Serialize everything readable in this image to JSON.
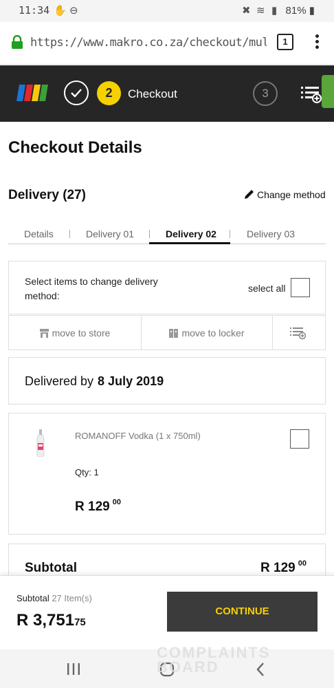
{
  "status_bar": {
    "time": "11:34",
    "battery": "81%"
  },
  "browser": {
    "url": "https://www.makro.co.za/checkout/multi/del",
    "tab_count": "1"
  },
  "header": {
    "current_step_number": "2",
    "current_step_label": "Checkout",
    "next_step_number": "3",
    "logo_colors": [
      "#1e73d8",
      "#e3262f",
      "#f6c90e",
      "#3aa23a"
    ]
  },
  "page": {
    "title": "Checkout Details",
    "delivery_title": "Delivery (27)",
    "change_method_label": "Change method"
  },
  "tabs": [
    {
      "label": "Details"
    },
    {
      "label": "Delivery 01"
    },
    {
      "label": "Delivery 02"
    },
    {
      "label": "Delivery 03"
    }
  ],
  "active_tab": "Delivery 02",
  "selection": {
    "instruction": "Select items to change delivery method:",
    "select_all_label": "select all"
  },
  "actions": {
    "move_to_store": "move to store",
    "move_to_locker": "move to locker"
  },
  "delivery": {
    "delivered_by_label": "Delivered by",
    "delivered_by_date": "8 July 2019"
  },
  "product": {
    "name": "ROMANOFF Vodka (1 x 750ml)",
    "qty": "Qty: 1",
    "price_main": "R 129",
    "price_cents": "00"
  },
  "subtotal_row": {
    "label": "Subtotal",
    "price_main": "R 129",
    "price_cents": "00"
  },
  "footer": {
    "subtotal_label": "Subtotal",
    "items_label": "27 Item(s)",
    "total_main": "R 3,751",
    "total_cents": "75",
    "continue_label": "CONTINUE"
  },
  "watermark": {
    "line1": "COMPLAINTS",
    "line2": "BOARD"
  },
  "colors": {
    "header_bg": "#262626",
    "accent_yellow": "#f6d100",
    "button_bg": "#3b3b3b",
    "green_tab": "#5aa63a"
  }
}
